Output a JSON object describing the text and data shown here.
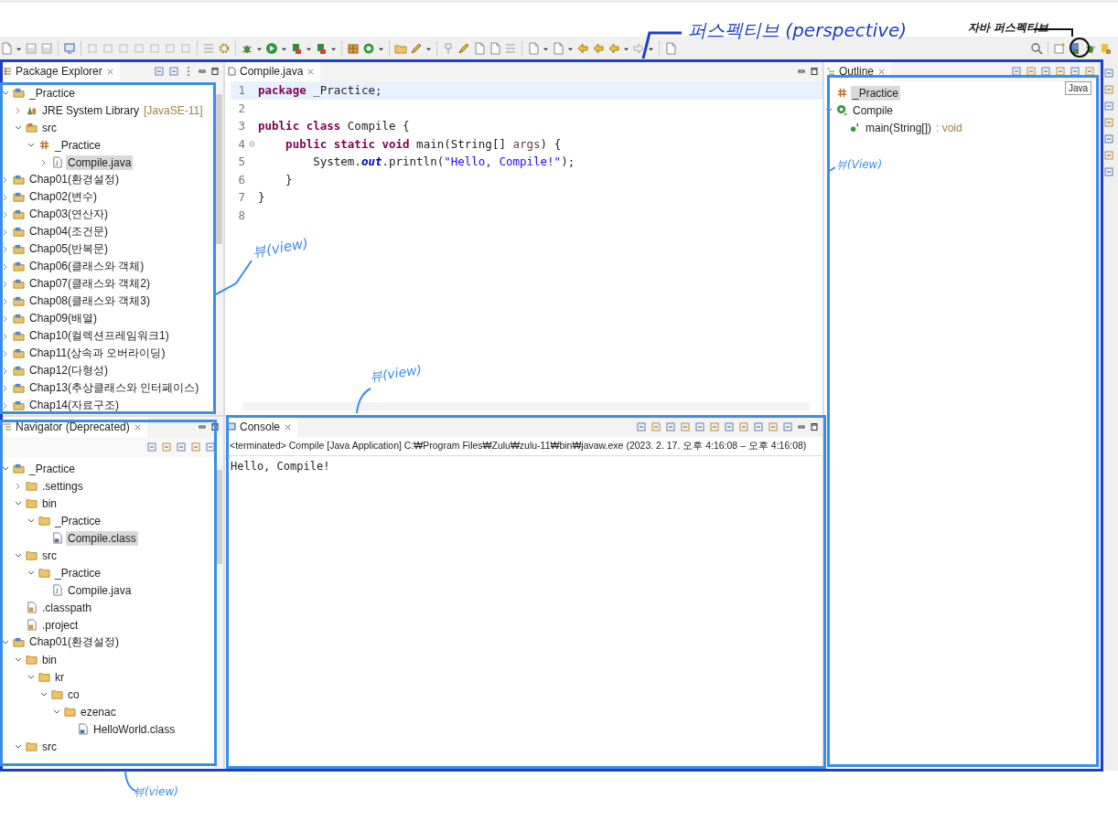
{
  "annotations": [
    {
      "text": "퍼스펙티브 (perspective)"
    },
    {
      "text": "자바 퍼스펙티브"
    },
    {
      "text": "뷰(view)"
    },
    {
      "text": "뷰(view)"
    },
    {
      "text": "뷰(View)"
    },
    {
      "text": "뷰(view)"
    }
  ],
  "tooltip": "Java",
  "package_explorer": {
    "tab": {
      "label": "Package Explorer",
      "selected": true
    },
    "tree": [
      {
        "label": "_Practice",
        "kind": "project",
        "expanded": true,
        "selected": false,
        "children": [
          {
            "label": "JRE System Library",
            "suffix": "[JavaSE-11]",
            "kind": "library",
            "expanded": false,
            "selected": false
          },
          {
            "label": "src",
            "kind": "srcfolder",
            "expanded": true,
            "selected": false,
            "children": [
              {
                "label": "_Practice",
                "kind": "package",
                "expanded": true,
                "selected": false,
                "children": [
                  {
                    "label": "Compile.java",
                    "kind": "javafile",
                    "expanded": false,
                    "selected": true
                  }
                ]
              }
            ]
          }
        ]
      },
      {
        "label": "Chap01(환경설정)",
        "kind": "project",
        "expanded": false,
        "selected": false
      },
      {
        "label": "Chap02(변수)",
        "kind": "project",
        "expanded": false,
        "selected": false
      },
      {
        "label": "Chap03(연산자)",
        "kind": "project",
        "expanded": false,
        "selected": false
      },
      {
        "label": "Chap04(조건문)",
        "kind": "project",
        "expanded": false,
        "selected": false
      },
      {
        "label": "Chap05(반복문)",
        "kind": "project",
        "expanded": false,
        "selected": false
      },
      {
        "label": "Chap06(클래스와 객체)",
        "kind": "project",
        "expanded": false,
        "selected": false
      },
      {
        "label": "Chap07(클래스와 객체2)",
        "kind": "project",
        "expanded": false,
        "selected": false
      },
      {
        "label": "Chap08(클래스와 객체3)",
        "kind": "project",
        "expanded": false,
        "selected": false
      },
      {
        "label": "Chap09(배열)",
        "kind": "project",
        "expanded": false,
        "selected": false
      },
      {
        "label": "Chap10(컬렉션프레임워크1)",
        "kind": "project",
        "expanded": false,
        "selected": false
      },
      {
        "label": "Chap11(상속과 오버라이딩)",
        "kind": "project",
        "expanded": false,
        "selected": false
      },
      {
        "label": "Chap12(다형성)",
        "kind": "project",
        "expanded": false,
        "selected": false
      },
      {
        "label": "Chap13(추상클래스와 인터페이스)",
        "kind": "project",
        "expanded": false,
        "selected": false
      },
      {
        "label": "Chap14(자료구조)",
        "kind": "project",
        "expanded": false,
        "selected": false
      }
    ]
  },
  "navigator": {
    "tab": {
      "label": "Navigator (Deprecated)",
      "selected": true
    },
    "tree": [
      {
        "label": "_Practice",
        "kind": "project",
        "expanded": true,
        "selected": false,
        "children": [
          {
            "label": ".settings",
            "kind": "folder",
            "expanded": false,
            "selected": false
          },
          {
            "label": "bin",
            "kind": "folder",
            "expanded": true,
            "selected": false,
            "children": [
              {
                "label": "_Practice",
                "kind": "folder",
                "expanded": true,
                "selected": false,
                "children": [
                  {
                    "label": "Compile.class",
                    "kind": "classfile",
                    "selected": true
                  }
                ]
              }
            ]
          },
          {
            "label": "src",
            "kind": "folder",
            "expanded": true,
            "selected": false,
            "children": [
              {
                "label": "_Practice",
                "kind": "folder",
                "expanded": true,
                "selected": false,
                "children": [
                  {
                    "label": "Compile.java",
                    "kind": "javafile",
                    "selected": false
                  }
                ]
              }
            ]
          },
          {
            "label": ".classpath",
            "kind": "textfile",
            "selected": false
          },
          {
            "label": ".project",
            "kind": "textfile",
            "selected": false
          }
        ]
      },
      {
        "label": "Chap01(환경설정)",
        "kind": "project",
        "expanded": true,
        "selected": false,
        "children": [
          {
            "label": "bin",
            "kind": "folder",
            "expanded": true,
            "selected": false,
            "children": [
              {
                "label": "kr",
                "kind": "folder",
                "expanded": true,
                "selected": false,
                "children": [
                  {
                    "label": "co",
                    "kind": "folder",
                    "expanded": true,
                    "selected": false,
                    "children": [
                      {
                        "label": "ezenac",
                        "kind": "folder",
                        "expanded": true,
                        "selected": false,
                        "children": [
                          {
                            "label": "HelloWorld.class",
                            "kind": "classfile",
                            "selected": false
                          }
                        ]
                      }
                    ]
                  }
                ]
              }
            ]
          },
          {
            "label": "src",
            "kind": "folder",
            "expanded": true,
            "selected": false
          }
        ]
      }
    ]
  },
  "editor": {
    "tab": {
      "label": "Compile.java",
      "selected": true
    },
    "lines": [
      {
        "number": "1",
        "current": true,
        "segments": [
          {
            "kind": "keyword",
            "text": "package"
          },
          {
            "kind": "plain",
            "text": " _Practice;"
          }
        ]
      },
      {
        "number": "2",
        "current": false
      },
      {
        "number": "3",
        "current": false,
        "segments": [
          {
            "kind": "keyword",
            "text": "public class"
          },
          {
            "kind": "plain",
            "text": " Compile {"
          }
        ]
      },
      {
        "number": "4",
        "current": false,
        "fold": true,
        "segments": [
          {
            "kind": "keyword",
            "text": "    public static void"
          },
          {
            "kind": "plain",
            "text": " main(String[] "
          },
          {
            "kind": "param",
            "text": "args"
          },
          {
            "kind": "plain",
            "text": ") {"
          }
        ]
      },
      {
        "number": "5",
        "current": false,
        "segments": [
          {
            "kind": "plain",
            "text": "        System."
          },
          {
            "kind": "field",
            "text": "out"
          },
          {
            "kind": "plain",
            "text": ".println("
          },
          {
            "kind": "string",
            "text": "\"Hello, Compile!\""
          },
          {
            "kind": "plain",
            "text": ");"
          }
        ]
      },
      {
        "number": "6",
        "current": false,
        "segments": [
          {
            "kind": "plain",
            "text": "    }"
          }
        ]
      },
      {
        "number": "7",
        "current": false,
        "segments": [
          {
            "kind": "plain",
            "text": "}"
          }
        ]
      },
      {
        "number": "8",
        "current": false
      }
    ]
  },
  "console": {
    "tab": {
      "label": "Console",
      "selected": true
    },
    "status": "<terminated> Compile [Java Application] C:₩Program Files₩Zulu₩zulu-11₩bin₩javaw.exe  (2023. 2. 17. 오후 4:16:08 – 오후 4:16:08)",
    "output": "Hello, Compile!"
  },
  "outline": {
    "tab": {
      "label": "Outline",
      "selected": true
    },
    "tree": [
      {
        "label": "_Practice",
        "kind": "package",
        "selected": true
      },
      {
        "label": "Compile",
        "kind": "class",
        "expanded": true,
        "selected": false,
        "children": [
          {
            "label": "main(String[])",
            "suffix": ": void",
            "kind": "method",
            "selected": false
          }
        ]
      }
    ]
  }
}
